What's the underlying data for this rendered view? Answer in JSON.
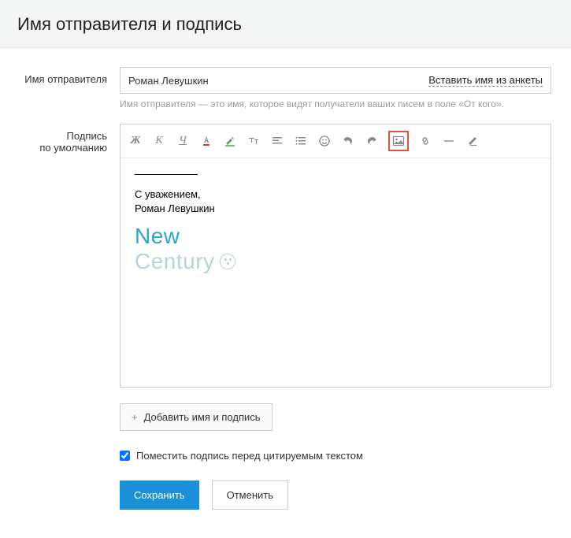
{
  "header": {
    "title": "Имя отправителя и подпись"
  },
  "sender": {
    "label": "Имя отправителя",
    "value": "Роман Левушкин",
    "insert_link": "Вставить имя из анкеты",
    "hint": "Имя отправителя — это имя, которое видят получатели ваших писем в поле «От кого»."
  },
  "signature": {
    "label_line1": "Подпись",
    "label_line2": "по умолчанию",
    "body_line1": "С уважением,",
    "body_line2": "Роман Левушкин",
    "logo_line1": "New",
    "logo_line2": "Century"
  },
  "toolbar": {
    "bold": "Ж",
    "italic": "К",
    "underline": "Ч"
  },
  "add_button": "Добавить имя и подпись",
  "checkbox_label": "Поместить подпись перед цитируемым текстом",
  "checkbox_checked": true,
  "actions": {
    "save": "Сохранить",
    "cancel": "Отменить"
  }
}
